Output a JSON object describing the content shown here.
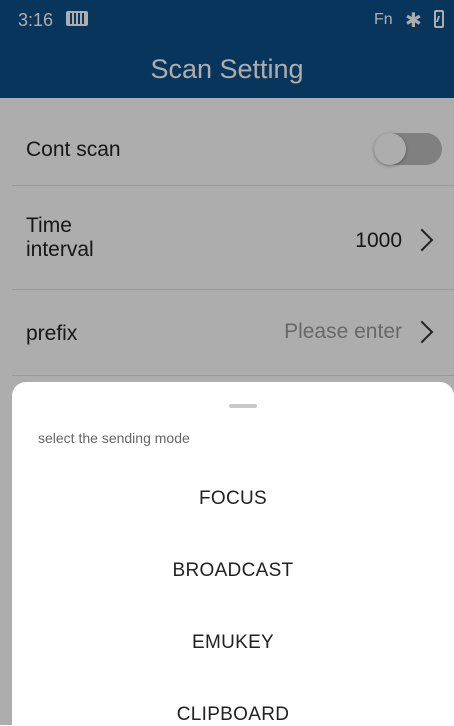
{
  "status_bar": {
    "time": "3:16",
    "fn_label": "Fn",
    "icons": [
      "sim-card-icon",
      "bluetooth-icon",
      "battery-charging-icon"
    ]
  },
  "app_bar": {
    "title": "Scan Setting",
    "color": "#0c4f86"
  },
  "settings": {
    "cont_scan": {
      "label": "Cont scan",
      "enabled": false
    },
    "time_interval": {
      "label_line1": "Time",
      "label_line2": "interval",
      "value": "1000"
    },
    "prefix": {
      "label": "prefix",
      "placeholder": "Please enter"
    }
  },
  "bottom_sheet": {
    "title": "select the sending mode",
    "options": [
      "FOCUS",
      "BROADCAST",
      "EMUKEY",
      "CLIPBOARD"
    ]
  }
}
